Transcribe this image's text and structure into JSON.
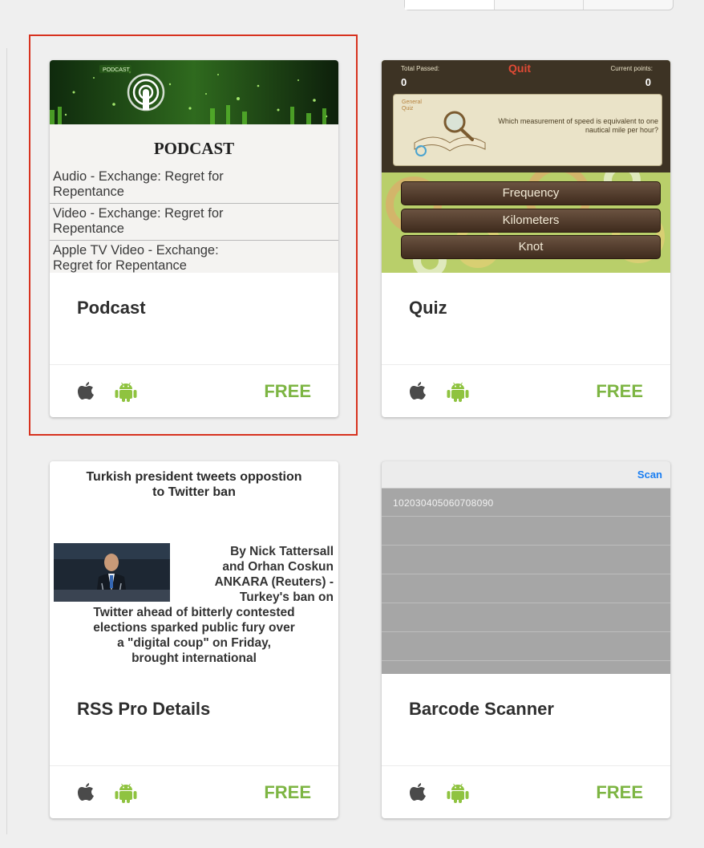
{
  "cards": [
    {
      "title": "Podcast",
      "subtitle": "",
      "price": "FREE",
      "preview": {
        "banner_text": "PODCAST",
        "heading": "PODCAST",
        "items": [
          {
            "line1": "Audio - Exchange: Regret for",
            "line2": "Repentance"
          },
          {
            "line1": "Video - Exchange: Regret for",
            "line2": "Repentance"
          },
          {
            "line1": "Apple TV Video - Exchange:",
            "line2": "Regret for Repentance"
          }
        ]
      }
    },
    {
      "title": "Quiz",
      "subtitle": "",
      "price": "FREE",
      "preview": {
        "total_passed_label": "Total Passed:",
        "total_passed_value": "0",
        "quit_label": "Quit",
        "current_points_label": "Current points:",
        "current_points_value": "0",
        "corner_label_1": "General",
        "corner_label_2": "Quiz",
        "question": "Which measurement of speed is equivalent to one nautical mile per hour?",
        "answers": [
          "Frequency",
          "Kilometers",
          "Knot"
        ]
      }
    },
    {
      "title": "RSS Pro Details",
      "subtitle": "",
      "price": "FREE",
      "preview": {
        "headline_line1": "Turkish president tweets oppostion",
        "headline_line2": "to Twitter ban",
        "side_lines": [
          "By Nick Tattersall",
          "and Orhan Coskun",
          "ANKARA (Reuters) -",
          "Turkey's ban on"
        ],
        "body_lines": [
          "Twitter ahead of bitterly contested",
          "elections sparked public fury over",
          "a \"digital coup\" on Friday,",
          "brought international"
        ]
      }
    },
    {
      "title": "Barcode Scanner",
      "subtitle": "",
      "price": "FREE",
      "preview": {
        "scan_label": "Scan",
        "value": "102030405060708090"
      }
    }
  ],
  "colors": {
    "accent_price": "#7db543",
    "selection_border": "#d7321f",
    "scan_link": "#1a7ef2"
  },
  "icons": [
    "apple-icon",
    "android-icon"
  ]
}
